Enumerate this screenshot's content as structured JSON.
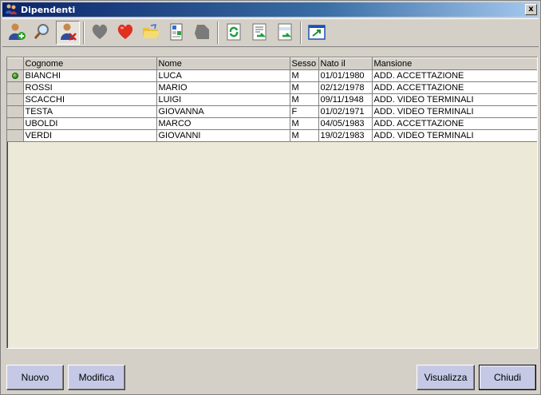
{
  "window": {
    "title": "Dipendenti",
    "close_label": "x"
  },
  "toolbar": {
    "buttons": [
      {
        "icon": "user-add-icon"
      },
      {
        "icon": "magnifier-icon"
      },
      {
        "icon": "user-delete-icon",
        "pressed": true
      },
      {
        "icon": "gray-heart-icon"
      },
      {
        "icon": "red-heart-icon"
      },
      {
        "icon": "folder-open-icon"
      },
      {
        "icon": "id-card-icon"
      },
      {
        "icon": "gray-shape-icon"
      },
      {
        "icon": "refresh-icon"
      },
      {
        "icon": "document-refresh-icon"
      },
      {
        "icon": "info-document-icon"
      },
      {
        "icon": "export-window-icon"
      }
    ]
  },
  "grid": {
    "columns": [
      "Cognome",
      "Nome",
      "Sesso",
      "Nato il",
      "Mansione"
    ],
    "rows": [
      {
        "cognome": "BIANCHI",
        "nome": "LUCA",
        "sesso": "M",
        "nato": "01/01/1980",
        "mansione": "ADD. ACCETTAZIONE",
        "selected": true
      },
      {
        "cognome": "ROSSI",
        "nome": "MARIO",
        "sesso": "M",
        "nato": "02/12/1978",
        "mansione": "ADD. ACCETTAZIONE"
      },
      {
        "cognome": "SCACCHI",
        "nome": "LUIGI",
        "sesso": "M",
        "nato": "09/11/1948",
        "mansione": "ADD. VIDEO TERMINALI"
      },
      {
        "cognome": "TESTA",
        "nome": "GIOVANNA",
        "sesso": "F",
        "nato": "01/02/1971",
        "mansione": "ADD. VIDEO TERMINALI"
      },
      {
        "cognome": "UBOLDI",
        "nome": "MARCO",
        "sesso": "M",
        "nato": "04/05/1983",
        "mansione": "ADD. ACCETTAZIONE"
      },
      {
        "cognome": "VERDI",
        "nome": "GIOVANNI",
        "sesso": "M",
        "nato": "19/02/1983",
        "mansione": "ADD. VIDEO TERMINALI"
      }
    ]
  },
  "buttons": {
    "nuovo": "Nuovo",
    "modifica": "Modifica",
    "visualizza": "Visualizza",
    "chiudi": "Chiudi"
  }
}
